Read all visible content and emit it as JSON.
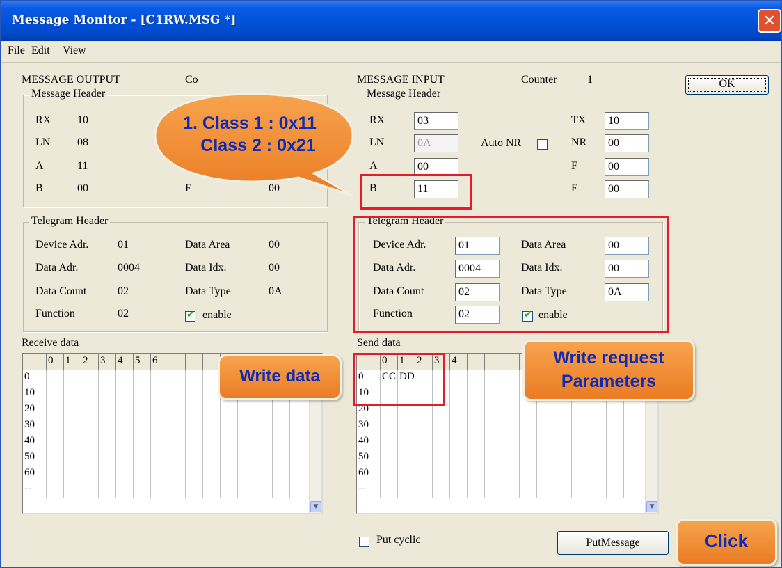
{
  "window": {
    "title": "Message Monitor - [C1RW.MSG *]",
    "close_glyph": "✕"
  },
  "menu": [
    "File",
    "Edit",
    "View"
  ],
  "output": {
    "section_label": "MESSAGE OUTPUT",
    "counter_label_partial": "Co",
    "message_header": {
      "caption": "Message Header",
      "rows": [
        {
          "label": "RX",
          "value": "10"
        },
        {
          "label": "LN",
          "value": "08"
        },
        {
          "label": "A",
          "value": "11"
        },
        {
          "label": "B",
          "value": "00"
        }
      ],
      "right_label_partial": "E",
      "right_value_partial": "00"
    },
    "telegram_header": {
      "caption": "Telegram Header",
      "device_adr": {
        "label": "Device Adr.",
        "value": "01"
      },
      "data_adr": {
        "label": "Data Adr.",
        "value": "0004"
      },
      "data_count": {
        "label": "Data Count",
        "value": "02"
      },
      "function": {
        "label": "Function",
        "value": "02"
      },
      "data_area": {
        "label": "Data Area",
        "value": "00"
      },
      "data_idx": {
        "label": "Data Idx.",
        "value": "00"
      },
      "data_type": {
        "label": "Data Type",
        "value": "0A"
      },
      "enable": {
        "label": "enable",
        "checked": true
      }
    },
    "grid_label": "Receive data",
    "grid_cols": [
      "0",
      "1",
      "2",
      "3",
      "4",
      "5",
      "6"
    ],
    "grid_rows": [
      "0",
      "10",
      "20",
      "30",
      "40",
      "50",
      "60",
      "--"
    ]
  },
  "input": {
    "section_label": "MESSAGE INPUT",
    "counter_label": "Counter",
    "counter_value": "1",
    "message_header": {
      "caption": "Message Header",
      "rx": {
        "label": "RX",
        "value": "03"
      },
      "ln": {
        "label": "LN",
        "value": "0A"
      },
      "a": {
        "label": "A",
        "value": "00"
      },
      "b": {
        "label": "B",
        "value": "11"
      },
      "tx": {
        "label": "TX",
        "value": "10"
      },
      "nr": {
        "label": "NR",
        "value": "00"
      },
      "f": {
        "label": "F",
        "value": "00"
      },
      "e": {
        "label": "E",
        "value": "00"
      },
      "auto_nr_label": "Auto NR",
      "auto_nr_checked": false
    },
    "telegram_header": {
      "caption": "Telegram Header",
      "device_adr": {
        "label": "Device Adr.",
        "value": "01"
      },
      "data_adr": {
        "label": "Data Adr.",
        "value": "0004"
      },
      "data_count": {
        "label": "Data Count",
        "value": "02"
      },
      "function": {
        "label": "Function",
        "value": "02"
      },
      "data_area": {
        "label": "Data Area",
        "value": "00"
      },
      "data_idx": {
        "label": "Data Idx.",
        "value": "00"
      },
      "data_type": {
        "label": "Data Type",
        "value": "0A"
      },
      "enable": {
        "label": "enable",
        "checked": true
      }
    },
    "grid_label": "Send data",
    "grid_cols": [
      "0",
      "1",
      "2",
      "3",
      "4"
    ],
    "grid_rows": [
      "0",
      "10",
      "20",
      "30",
      "40",
      "50",
      "60",
      "--"
    ],
    "grid_row0_values": [
      "CC",
      "DD"
    ]
  },
  "buttons": {
    "ok": "OK",
    "put_message": "PutMessage"
  },
  "put_cyclic": {
    "label": "Put cyclic",
    "checked": false
  },
  "annotations": {
    "class_line1": "1. Class 1 : 0x11",
    "class_line2": "Class 2 : 0x21",
    "write_data": "Write data",
    "write_request_line1": "Write request",
    "write_request_line2": "Parameters",
    "click": "Click"
  },
  "colors": {
    "titlebar": "#0052d9",
    "callout": "#f39032",
    "callout_text": "#0d2bb9",
    "highlight": "#e41c2c",
    "dialog_bg": "#ece9d8"
  }
}
